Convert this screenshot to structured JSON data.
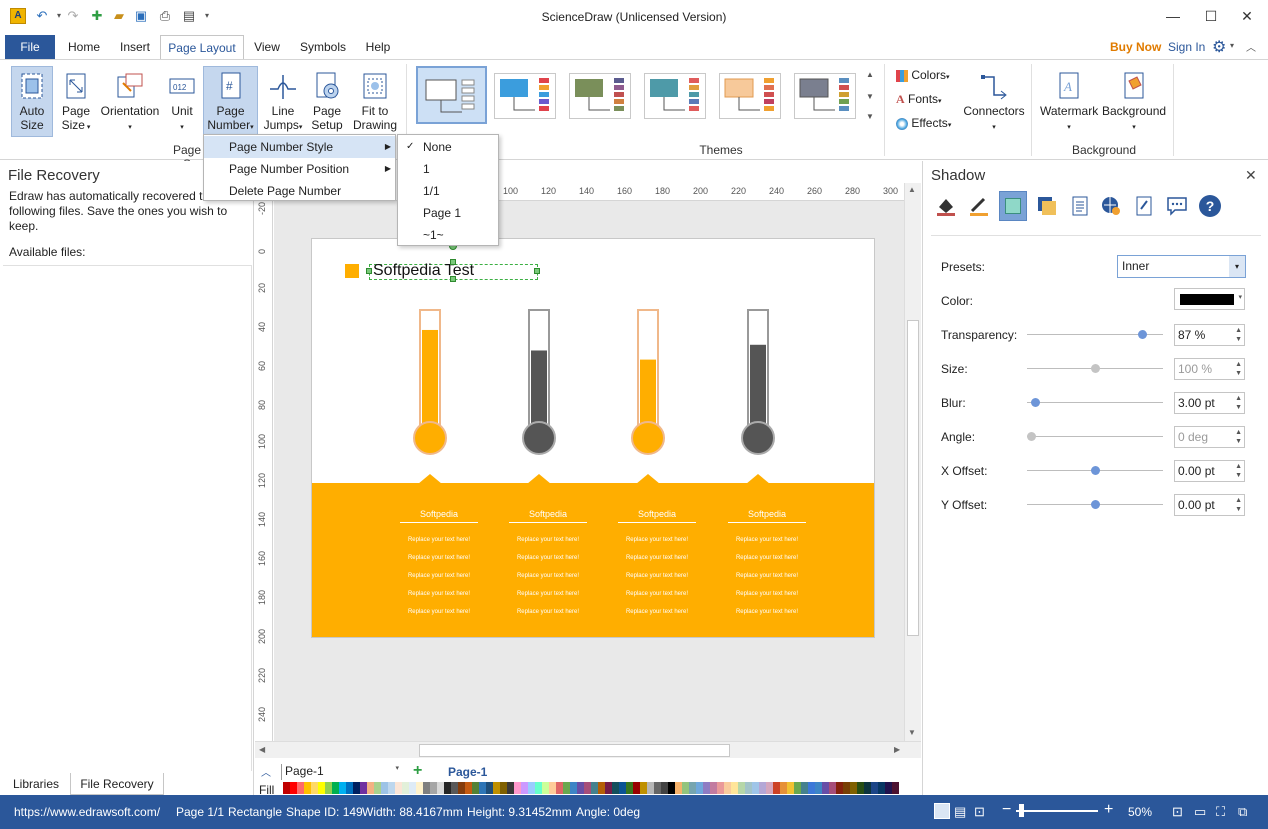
{
  "window": {
    "title": "ScienceDraw (Unlicensed Version)"
  },
  "tabs": [
    "File",
    "Home",
    "Insert",
    "Page Layout",
    "View",
    "Symbols",
    "Help"
  ],
  "account": {
    "buy_now": "Buy Now",
    "sign_in": "Sign In"
  },
  "ribbon": {
    "page_setup": {
      "auto_size": "Auto\nSize",
      "page_size": "Page\nSize",
      "orientation": "Orientation",
      "unit": "Unit",
      "page_number": "Page\nNumber",
      "line_jumps": "Line\nJumps",
      "page_setup": "Page\nSetup",
      "fit_to_drawing": "Fit to\nDrawing",
      "group_label": "Page S"
    },
    "themes": {
      "group_label": "Themes"
    },
    "theme_options": {
      "colors": "Colors",
      "fonts": "Fonts",
      "effects": "Effects",
      "connectors": "Connectors"
    },
    "background": {
      "watermark": "Watermark",
      "background": "Background",
      "group_label": "Background"
    }
  },
  "page_number_menu": {
    "items": [
      "Page Number Style",
      "Page Number Position",
      "Delete Page Number"
    ],
    "styles": [
      "None",
      "1",
      "1/1",
      "Page 1",
      "~1~"
    ],
    "selected_style": "None"
  },
  "left_panel": {
    "title": "File Recovery",
    "message": "Edraw has automatically recovered the following files. Save the ones you wish to keep.",
    "available_label": "Available files:",
    "bottom_tabs": [
      "Libraries",
      "File Recovery"
    ]
  },
  "ruler": {
    "h_ticks": [
      "100",
      "120",
      "140",
      "160",
      "180",
      "200",
      "220",
      "240",
      "260",
      "280",
      "300"
    ],
    "v_ticks": [
      "-20",
      "0",
      "20",
      "40",
      "60",
      "80",
      "100",
      "120",
      "140",
      "160",
      "180",
      "200",
      "220",
      "240"
    ]
  },
  "document": {
    "title_text": "Softpedia Test",
    "orange": "#FFAE00",
    "dark": "#555555",
    "thermometers": [
      {
        "color": "#FFAE00",
        "level": 0.86
      },
      {
        "color": "#555555",
        "level": 0.68
      },
      {
        "color": "#FFAE00",
        "level": 0.6
      },
      {
        "color": "#555555",
        "level": 0.73
      }
    ],
    "columns": [
      {
        "heading": "Softpedia",
        "lines": [
          "Replace your text here!",
          "Replace your text here!",
          "Replace your text here!",
          "Replace your text here!",
          "Replace your text here!"
        ]
      },
      {
        "heading": "Softpedia",
        "lines": [
          "Replace your text here!",
          "Replace your text here!",
          "Replace your text here!",
          "Replace your text here!",
          "Replace your text here!"
        ]
      },
      {
        "heading": "Softpedia",
        "lines": [
          "Replace your text here!",
          "Replace your text here!",
          "Replace your text here!",
          "Replace your text here!",
          "Replace your text here!"
        ]
      },
      {
        "heading": "Softpedia",
        "lines": [
          "Replace your text here!",
          "Replace your text here!",
          "Replace your text here!",
          "Replace your text here!",
          "Replace your text here!"
        ]
      }
    ]
  },
  "page_tabs": {
    "selector": "Page-1",
    "active": "Page-1",
    "fill_label": "Fill"
  },
  "shadow_panel": {
    "title": "Shadow",
    "presets_label": "Presets:",
    "presets_value": "Inner",
    "color_label": "Color:",
    "color_value": "#000000",
    "props": [
      {
        "label": "Transparency:",
        "value": "87 %",
        "pos": 0.87,
        "enabled": true
      },
      {
        "label": "Size:",
        "value": "100 %",
        "pos": 0.5,
        "enabled": false
      },
      {
        "label": "Blur:",
        "value": "3.00 pt",
        "pos": 0.03,
        "enabled": true
      },
      {
        "label": "Angle:",
        "value": "0 deg",
        "pos": 0.0,
        "enabled": false
      },
      {
        "label": "X Offset:",
        "value": "0.00 pt",
        "pos": 0.5,
        "enabled": true
      },
      {
        "label": "Y Offset:",
        "value": "0.00 pt",
        "pos": 0.5,
        "enabled": true
      }
    ]
  },
  "statusbar": {
    "url": "https://www.edrawsoft.com/",
    "page": "Page 1/1",
    "shape": "Rectangle",
    "shape_id": "Shape ID: 149",
    "width": "Width: 88.4167mm",
    "height": "Height: 9.31452mm",
    "angle": "Angle: 0deg",
    "zoom": "50%"
  },
  "palette": [
    "#c00000",
    "#ff0000",
    "#ff6a6a",
    "#ffc000",
    "#ffd966",
    "#ffff00",
    "#92d050",
    "#00b050",
    "#00b0f0",
    "#0070c0",
    "#002060",
    "#7030a0",
    "#f4b183",
    "#a9d18e",
    "#9dc3e6",
    "#bdd7ee",
    "#fbe5d6",
    "#e2f0d9",
    "#deebf7",
    "#fff2cc",
    "#7f7f7f",
    "#a6a6a6",
    "#d9d9d9",
    "#262626",
    "#595959",
    "#843c0c",
    "#c55a11",
    "#538135",
    "#2e75b6",
    "#1f4e79",
    "#bf9000",
    "#7f6000",
    "#3a3838",
    "#ff99cc",
    "#cc99ff",
    "#99ccff",
    "#66ffcc",
    "#ccff99",
    "#ffcc99",
    "#e06666",
    "#6aa84f",
    "#3d85c6",
    "#674ea7",
    "#a64d79",
    "#45818e",
    "#b45f06",
    "#741b47",
    "#134f5c",
    "#0b5394",
    "#38761d",
    "#990000",
    "#bf9000",
    "#b7b7b7",
    "#666666",
    "#434343",
    "#000000",
    "#f6b26b",
    "#93c47d",
    "#76a5af",
    "#6fa8dc",
    "#8e7cc3",
    "#c27ba0",
    "#ea9999",
    "#f9cb9c",
    "#ffe599",
    "#b6d7a8",
    "#a2c4c9",
    "#9fc5e8",
    "#b4a7d6",
    "#d5a6bd",
    "#cc4125",
    "#e69138",
    "#f1c232",
    "#6aa84f",
    "#45818e",
    "#3c78d8",
    "#3d85c6",
    "#674ea7",
    "#a64d79",
    "#85200c",
    "#783f04",
    "#7f6000",
    "#274e13",
    "#0c343d",
    "#1c4587",
    "#073763",
    "#20124d",
    "#4c1130"
  ]
}
